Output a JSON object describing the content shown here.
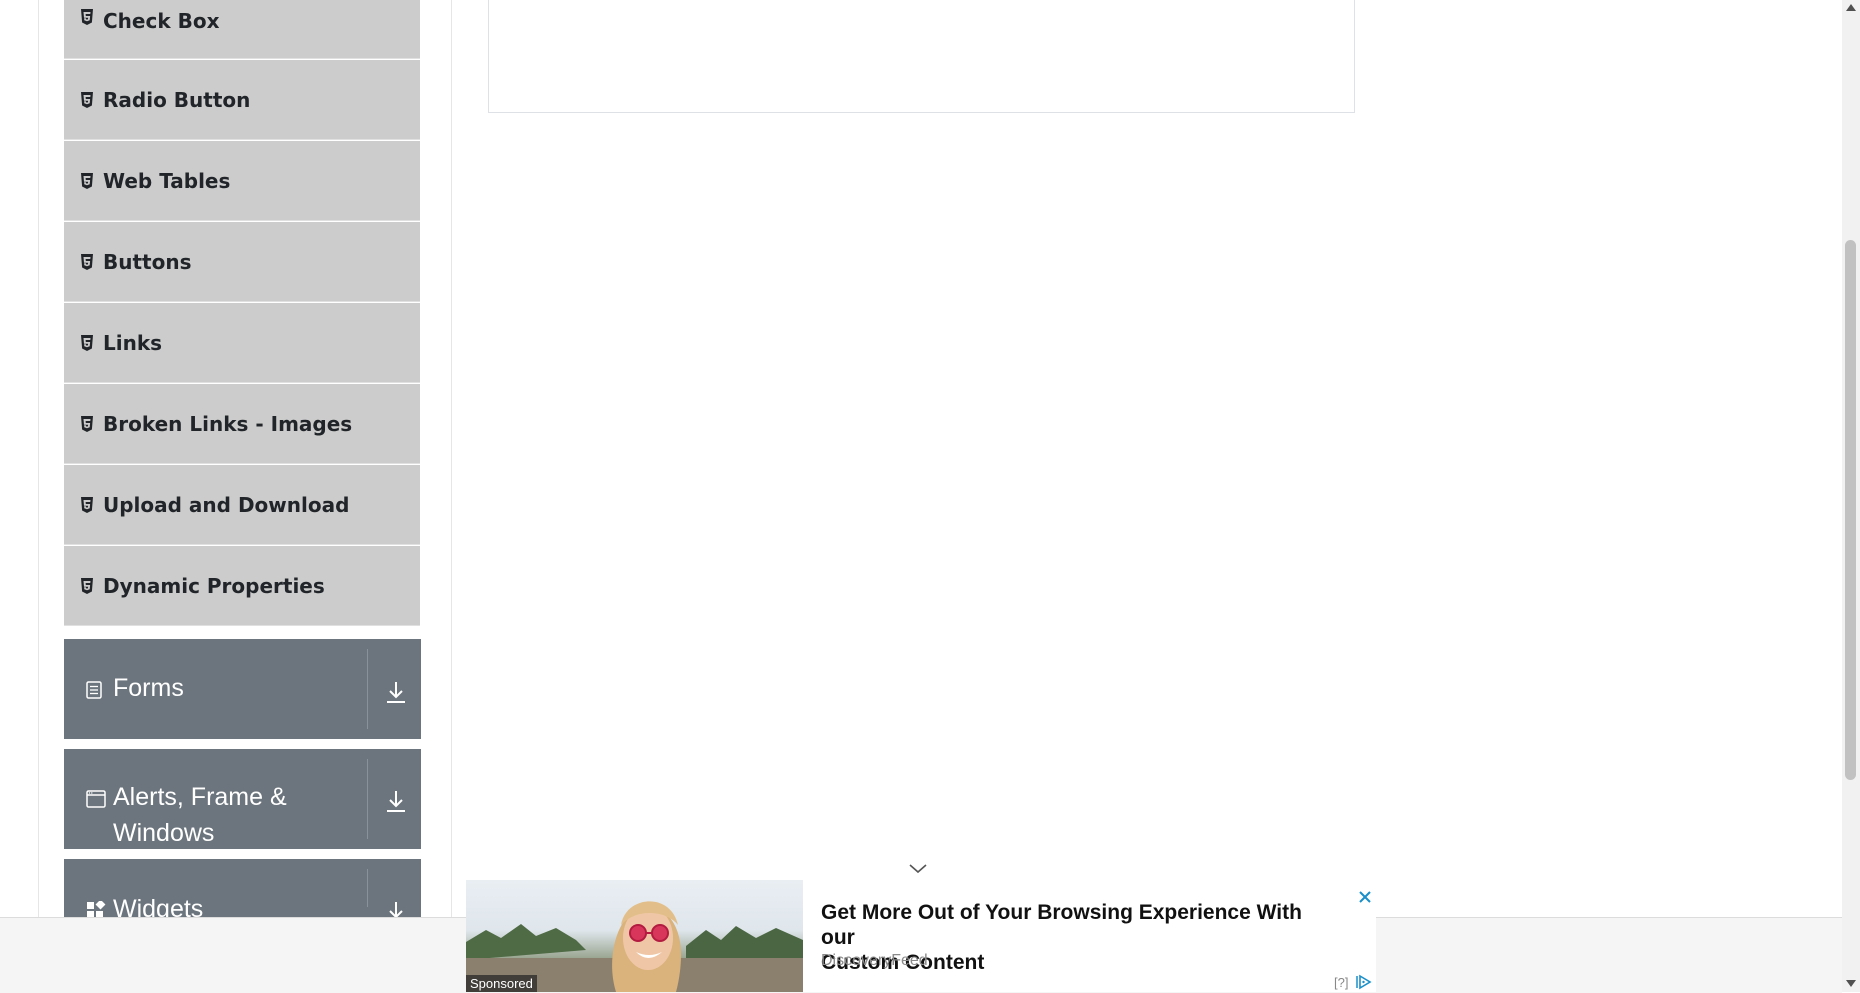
{
  "sidebar": {
    "elements_items": [
      {
        "label": "Check Box"
      },
      {
        "label": "Radio Button"
      },
      {
        "label": "Web Tables"
      },
      {
        "label": "Buttons"
      },
      {
        "label": "Links"
      },
      {
        "label": "Broken Links - Images"
      },
      {
        "label": "Upload and Download"
      },
      {
        "label": "Dynamic Properties"
      }
    ],
    "groups": [
      {
        "label": "Forms"
      },
      {
        "label": "Alerts, Frame &",
        "label_line2": "Windows"
      },
      {
        "label": "Widgets"
      }
    ]
  },
  "ad": {
    "title_line1": "Get More Out of Your Browsing Experience With our",
    "title_line2": "Custom Content",
    "source": "DiscoveryFeed",
    "sponsored": "Sponsored",
    "info": "[?]"
  },
  "colors": {
    "menu_item_bg": "#cccccc",
    "group_bg": "#6c757d",
    "ad_close": "#1a8fc9"
  }
}
